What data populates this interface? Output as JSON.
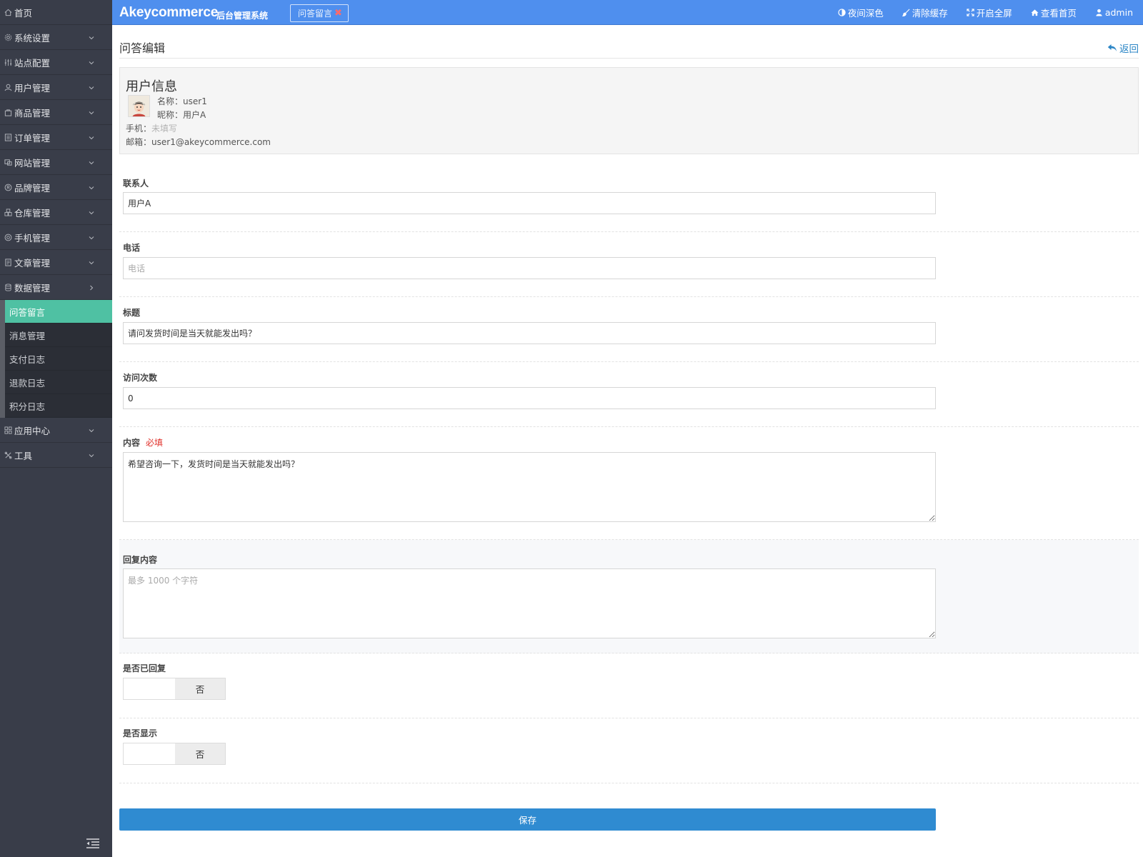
{
  "sidebar": {
    "items": [
      {
        "label": "首页",
        "icon": "home-icon"
      },
      {
        "label": "系统设置",
        "icon": "gear-icon"
      },
      {
        "label": "站点配置",
        "icon": "sliders-icon"
      },
      {
        "label": "用户管理",
        "icon": "user-icon"
      },
      {
        "label": "商品管理",
        "icon": "bag-icon"
      },
      {
        "label": "订单管理",
        "icon": "list-icon"
      },
      {
        "label": "网站管理",
        "icon": "site-icon"
      },
      {
        "label": "品牌管理",
        "icon": "registered-icon"
      },
      {
        "label": "仓库管理",
        "icon": "warehouse-icon"
      },
      {
        "label": "手机管理",
        "icon": "mobile-icon"
      },
      {
        "label": "文章管理",
        "icon": "article-icon"
      },
      {
        "label": "数据管理",
        "icon": "database-icon"
      },
      {
        "label": "应用中心",
        "icon": "apps-icon"
      },
      {
        "label": "工具",
        "icon": "tools-icon"
      }
    ],
    "sub_items": [
      "问答留言",
      "消息管理",
      "支付日志",
      "退款日志",
      "积分日志"
    ],
    "active_sub": "问答留言"
  },
  "topbar": {
    "logo": "Akeycommerce",
    "logo_sub": "后台管理系统",
    "tab_label": "问答留言",
    "tab_close": "✖",
    "actions": {
      "night": "夜间深色",
      "clear_cache": "清除缓存",
      "fullscreen": "开启全屏",
      "view_home": "查看首页",
      "user": "admin"
    }
  },
  "page": {
    "title": "问答编辑",
    "back": "返回"
  },
  "user_info": {
    "heading": "用户信息",
    "name_label": "名称：",
    "name": "user1",
    "nick_label": "昵称：",
    "nick": "用户A",
    "phone_label": "手机：",
    "phone": "未填写",
    "email_label": "邮箱：",
    "email": "user1@akeycommerce.com"
  },
  "form": {
    "contact": {
      "label": "联系人",
      "value": "用户A"
    },
    "phone": {
      "label": "电话",
      "value": "",
      "placeholder": "电话"
    },
    "title": {
      "label": "标题",
      "value": "请问发货时间是当天就能发出吗？"
    },
    "visits": {
      "label": "访问次数",
      "value": "0"
    },
    "content": {
      "label": "内容",
      "required": "必填",
      "value": "希望咨询一下，发货时间是当天就能发出吗？"
    },
    "reply": {
      "label": "回复内容",
      "value": "",
      "placeholder": "最多 1000 个字符"
    },
    "is_replied": {
      "label": "是否已回复",
      "state": "否"
    },
    "is_shown": {
      "label": "是否显示",
      "state": "否"
    },
    "save": "保存"
  },
  "colors": {
    "topbar": "#4f8fee",
    "sidebar": "#393d49",
    "active_sub": "#4fc1a3",
    "save_button": "#2f8bd1",
    "required": "#e0302a"
  }
}
